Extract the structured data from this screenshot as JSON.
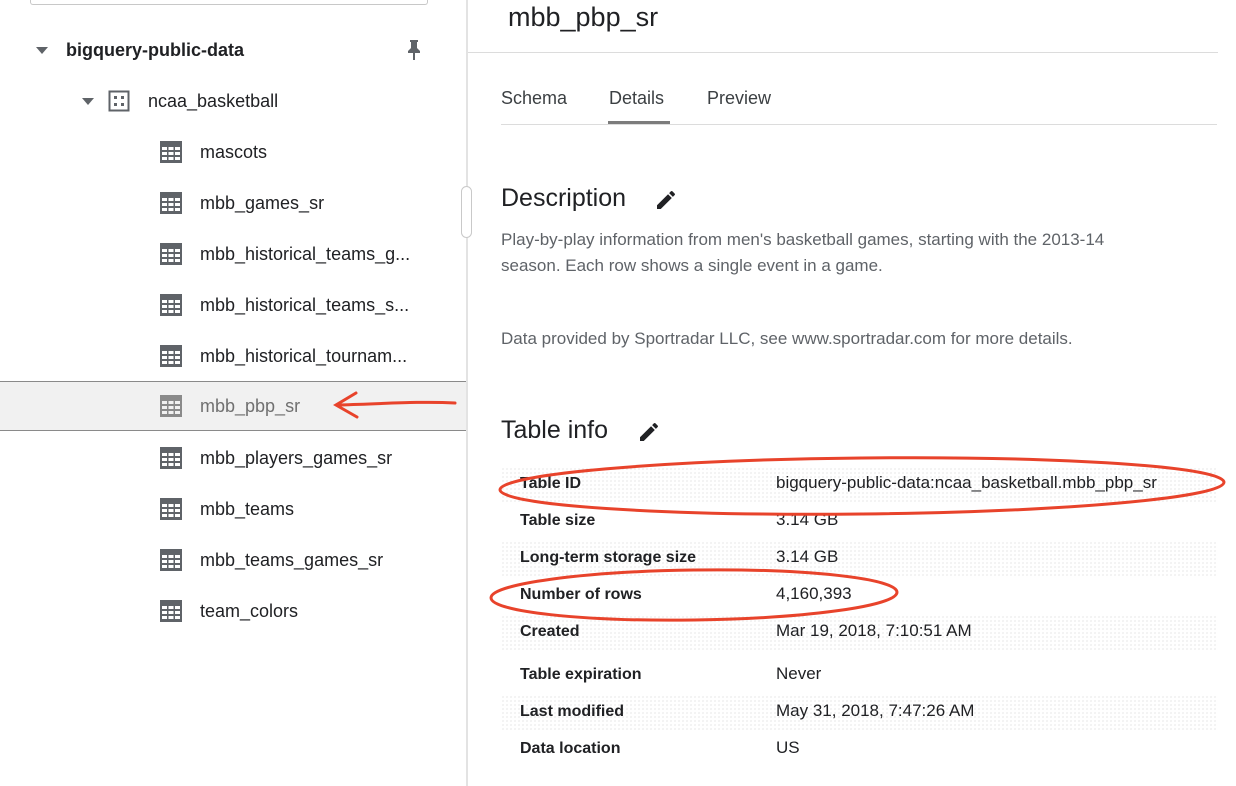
{
  "explorer": {
    "project": {
      "label": "bigquery-public-data",
      "pin_icon": "pin-icon"
    },
    "dataset": {
      "label": "ncaa_basketball",
      "icon": "dataset-icon"
    },
    "tables": [
      {
        "label": "mascots"
      },
      {
        "label": "mbb_games_sr"
      },
      {
        "label": "mbb_historical_teams_g..."
      },
      {
        "label": "mbb_historical_teams_s..."
      },
      {
        "label": "mbb_historical_tournam..."
      },
      {
        "label": "mbb_pbp_sr",
        "selected": true
      },
      {
        "label": "mbb_players_games_sr"
      },
      {
        "label": "mbb_teams"
      },
      {
        "label": "mbb_teams_games_sr"
      },
      {
        "label": "team_colors"
      }
    ]
  },
  "details": {
    "title": "mbb_pbp_sr",
    "tabs": [
      {
        "label": "Schema"
      },
      {
        "label": "Details",
        "active": true
      },
      {
        "label": "Preview"
      }
    ],
    "description": {
      "heading": "Description",
      "line1": "Play-by-play information from men's basketball games, starting with the 2013-14",
      "line2": "season. Each row shows a single event in a game.",
      "line3": "Data provided by Sportradar LLC, see www.sportradar.com for more details."
    },
    "table_info": {
      "heading": "Table info",
      "rows": [
        {
          "key": "Table ID",
          "value": "bigquery-public-data:ncaa_basketball.mbb_pbp_sr"
        },
        {
          "key": "Table size",
          "value": "3.14 GB"
        },
        {
          "key": "Long-term storage size",
          "value": "3.14 GB"
        },
        {
          "key": "Number of rows",
          "value": "4,160,393"
        },
        {
          "key": "Created",
          "value": "Mar 19, 2018, 7:10:51 AM"
        },
        {
          "key": "Table expiration",
          "value": "Never"
        },
        {
          "key": "Last modified",
          "value": "May 31, 2018, 7:47:26 AM"
        },
        {
          "key": "Data location",
          "value": "US"
        }
      ]
    }
  },
  "colors": {
    "annotation": "#e8432b",
    "active_tab_underline": "#7c7c7c",
    "selected_row_bg": "#f1f1f1"
  }
}
